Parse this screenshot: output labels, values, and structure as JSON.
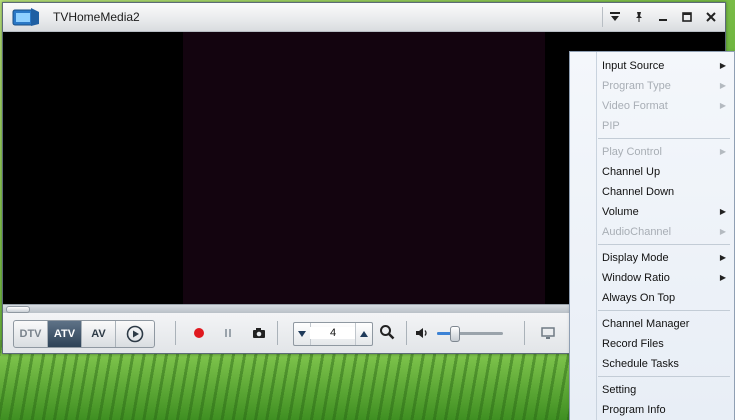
{
  "window": {
    "title": "TVHomeMedia2",
    "buttons": [
      {
        "name": "menu-dropdown-icon",
        "glyph": "⊽"
      },
      {
        "name": "pin-icon",
        "glyph": "✚"
      },
      {
        "name": "minimize-icon",
        "glyph": "–"
      },
      {
        "name": "maximize-icon",
        "glyph": "☐"
      },
      {
        "name": "close-icon",
        "glyph": "✕"
      }
    ]
  },
  "controls": {
    "modes": [
      "DTV",
      "ATV",
      "AV"
    ],
    "active_mode": "ATV",
    "channel": "4",
    "volume_fraction": 0.25
  },
  "menu": {
    "items": [
      {
        "label": "Input Source",
        "enabled": true,
        "submenu": true
      },
      {
        "label": "Program Type",
        "enabled": false,
        "submenu": true
      },
      {
        "label": "Video Format",
        "enabled": false,
        "submenu": true
      },
      {
        "label": "PIP",
        "enabled": false,
        "submenu": false
      },
      {
        "label": "Play Control",
        "enabled": false,
        "submenu": true
      },
      {
        "label": "Channel Up",
        "enabled": true,
        "submenu": false
      },
      {
        "label": "Channel Down",
        "enabled": true,
        "submenu": false
      },
      {
        "label": "Volume",
        "enabled": true,
        "submenu": true
      },
      {
        "label": "AudioChannel",
        "enabled": false,
        "submenu": true
      },
      {
        "label": "Display Mode",
        "enabled": true,
        "submenu": true
      },
      {
        "label": "Window Ratio",
        "enabled": true,
        "submenu": true
      },
      {
        "label": "Always On Top",
        "enabled": true,
        "submenu": false
      },
      {
        "label": "Channel Manager",
        "enabled": true,
        "submenu": false
      },
      {
        "label": "Record Files",
        "enabled": true,
        "submenu": false
      },
      {
        "label": "Schedule Tasks",
        "enabled": true,
        "submenu": false
      },
      {
        "label": "Setting",
        "enabled": true,
        "submenu": false
      },
      {
        "label": "Program Info",
        "enabled": true,
        "submenu": false
      }
    ]
  },
  "colors": {
    "record": "#e0191f",
    "active_mode_bg": "#2e4257",
    "volume_fill": "#3b82d6"
  }
}
